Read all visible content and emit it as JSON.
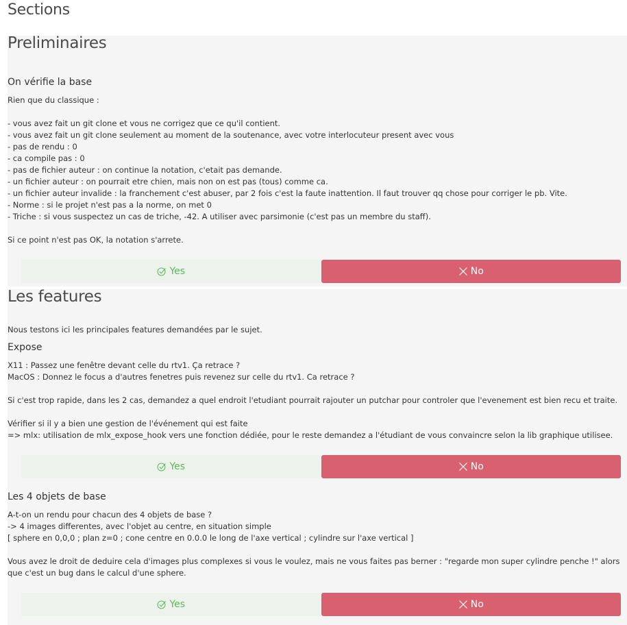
{
  "sections_title": "Sections",
  "preliminaires": {
    "title": "Preliminaires",
    "subtitle": "On vérifie la base",
    "body": "Rien que du classique :\n\n- vous avez fait un git clone et vous ne corrigez que ce qu'il contient.\n- vous avez fait un git clone seulement au moment de la soutenance, avec votre interlocuteur present avec vous\n- pas de rendu : 0\n- ca compile pas : 0\n- pas de fichier auteur : on continue la notation, c'etait pas demande.\n- un fichier auteur : on pourrait etre chien, mais non on est pas (tous) comme ca.\n- un fichier auteur invalide : la franchement c'est abuser, par 2 fois c'est la faute inattention. Il faut trouver qq chose pour corriger le pb. Vite.\n- Norme : si le projet n'est pas a la norme, on met 0\n- Triche : si vous suspectez un cas de triche, -42. A utiliser avec parsimonie (c'est pas un membre du staff).\n\nSi ce point n'est pas OK, la notation s'arrete.",
    "yes_label": "Yes",
    "no_label": "No"
  },
  "features": {
    "title": "Les features",
    "intro": "Nous testons ici les principales features demandées par le sujet.",
    "expose": {
      "subtitle": "Expose",
      "body": "X11 : Passez une fenêtre devant celle du rtv1. Ça retrace ?\nMacOS : Donnez le focus a d'autres fenetres puis revenez sur celle du rtv1. Ca retrace ?\n\nSi c'est trop rapide, dans les 2 cas, demandez a quel endroit l'etudiant pourrait rajouter un putchar pour controler que l'evenement est bien recu et traite.\n\nVérifier si il y a bien une gestion de l'événement qui est faite\n=> mlx: utilisation de mlx_expose_hook vers une fonction dédiée, pour le reste demandez a l'étudiant de vous convaincre selon la lib graphique utilisee.",
      "yes_label": "Yes",
      "no_label": "No"
    },
    "objets": {
      "subtitle": "Les 4 objets de base",
      "body": "A-t-on un rendu pour chacun des 4 objets de base ?\n-> 4 images differentes, avec l'objet au centre, en situation simple\n[ sphere en 0,0,0 ; plan z=0 ; cone centre en 0.0.0 le long de l'axe vertical ; cylindre sur l'axe vertical ]\n\nVous avez le droit de deduire cela d'images plus complexes si vous le voulez, mais ne vous faites pas berner : \"regarde mon super cylindre penche !\" alors que c'est un bug dans le calcul d'une sphere.",
      "yes_label": "Yes",
      "no_label": "No"
    }
  }
}
